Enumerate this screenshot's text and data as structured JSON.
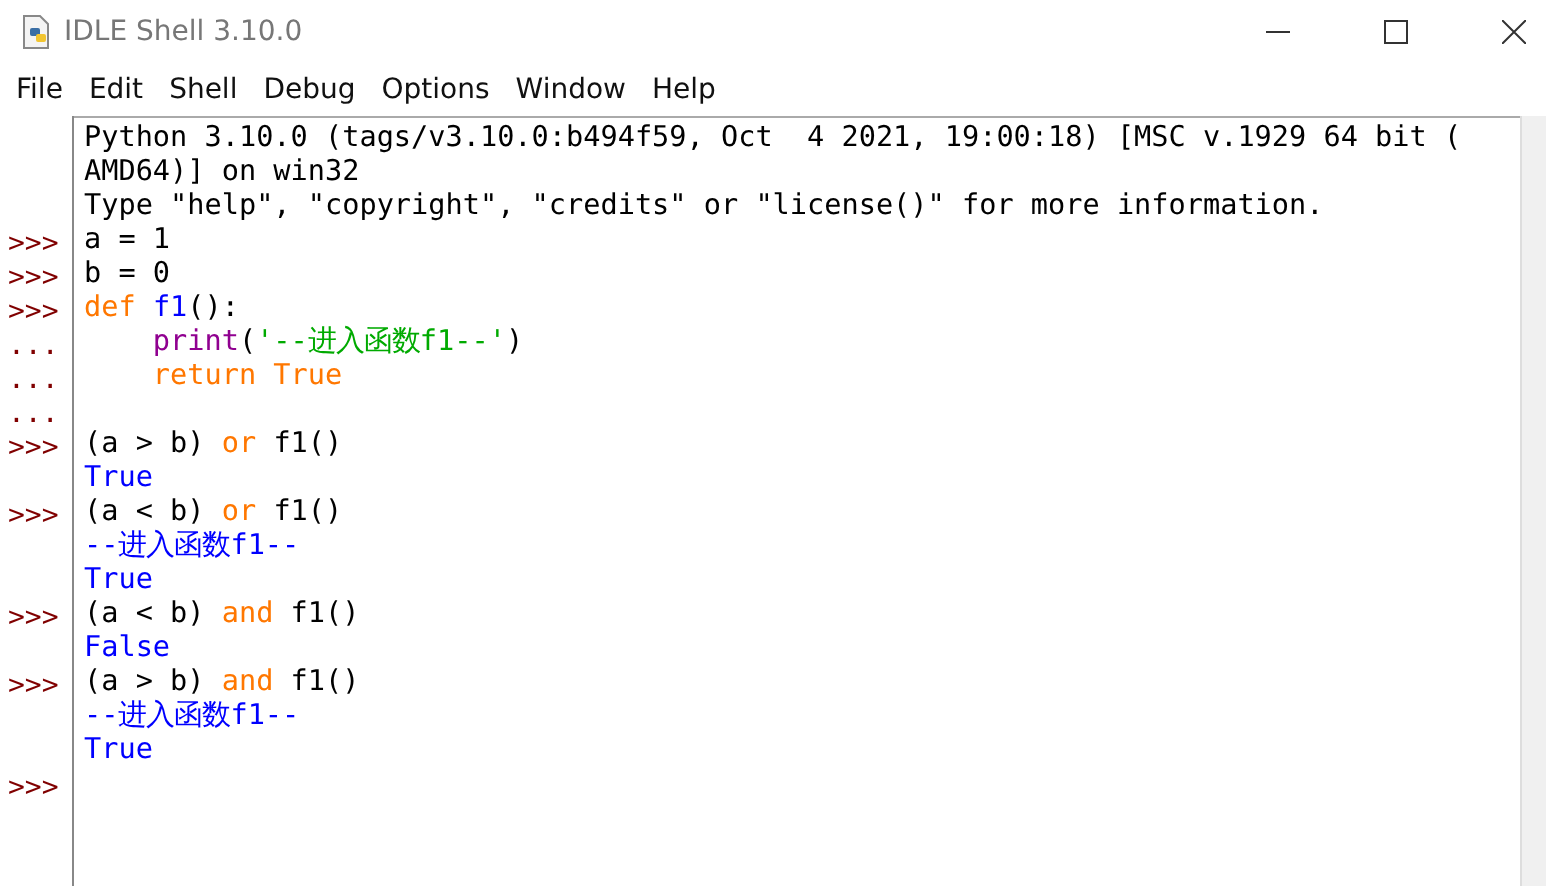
{
  "window": {
    "title": "IDLE Shell 3.10.0"
  },
  "menu": [
    "File",
    "Edit",
    "Shell",
    "Debug",
    "Options",
    "Window",
    "Help"
  ],
  "shell": {
    "lines": [
      {
        "tokens": [
          {
            "kind": "plain",
            "text": "Python 3.10.0 (tags/v3.10.0:b494f59, Oct  4 2021, 19:00:18) [MSC v.1929 64 bit ("
          }
        ]
      },
      {
        "tokens": [
          {
            "kind": "plain",
            "text": "AMD64)] on win32"
          }
        ]
      },
      {
        "tokens": [
          {
            "kind": "plain",
            "text": "Type \"help\", \"copyright\", \"credits\" or \"license()\" for more information."
          }
        ]
      },
      {
        "prompt": ">>>",
        "tokens": [
          {
            "kind": "plain",
            "text": "a = 1"
          }
        ]
      },
      {
        "prompt": ">>>",
        "tokens": [
          {
            "kind": "plain",
            "text": "b = 0"
          }
        ]
      },
      {
        "prompt": ">>>",
        "tokens": [
          {
            "kind": "keyword",
            "text": "def "
          },
          {
            "kind": "definition",
            "text": "f1"
          },
          {
            "kind": "plain",
            "text": "():"
          }
        ]
      },
      {
        "prompt": "...",
        "tokens": [
          {
            "kind": "builtin",
            "text": "    print"
          },
          {
            "kind": "plain",
            "text": "("
          },
          {
            "kind": "string",
            "text": "'--进入函数f1--'"
          },
          {
            "kind": "plain",
            "text": ")"
          }
        ]
      },
      {
        "prompt": "...",
        "tokens": [
          {
            "kind": "keyword",
            "text": "    return True"
          }
        ]
      },
      {
        "prompt": "..."
      },
      {
        "prompt": ">>>",
        "tokens": [
          {
            "kind": "plain",
            "text": "(a > b) "
          },
          {
            "kind": "keyword",
            "text": "or"
          },
          {
            "kind": "plain",
            "text": " f1()"
          }
        ]
      },
      {
        "tokens": [
          {
            "kind": "output",
            "text": "True"
          }
        ]
      },
      {
        "prompt": ">>>",
        "tokens": [
          {
            "kind": "plain",
            "text": "(a < b) "
          },
          {
            "kind": "keyword",
            "text": "or"
          },
          {
            "kind": "plain",
            "text": " f1()"
          }
        ]
      },
      {
        "tokens": [
          {
            "kind": "output",
            "text": "--进入函数f1--"
          }
        ]
      },
      {
        "tokens": [
          {
            "kind": "output",
            "text": "True"
          }
        ]
      },
      {
        "prompt": ">>>",
        "tokens": [
          {
            "kind": "plain",
            "text": "(a < b) "
          },
          {
            "kind": "keyword",
            "text": "and"
          },
          {
            "kind": "plain",
            "text": " f1()"
          }
        ]
      },
      {
        "tokens": [
          {
            "kind": "output",
            "text": "False"
          }
        ]
      },
      {
        "prompt": ">>>",
        "tokens": [
          {
            "kind": "plain",
            "text": "(a > b) "
          },
          {
            "kind": "keyword",
            "text": "and"
          },
          {
            "kind": "plain",
            "text": " f1()"
          }
        ]
      },
      {
        "tokens": [
          {
            "kind": "output",
            "text": "--进入函数f1--"
          }
        ]
      },
      {
        "tokens": [
          {
            "kind": "output",
            "text": "True"
          }
        ]
      },
      {
        "prompt": ">>>"
      }
    ]
  }
}
